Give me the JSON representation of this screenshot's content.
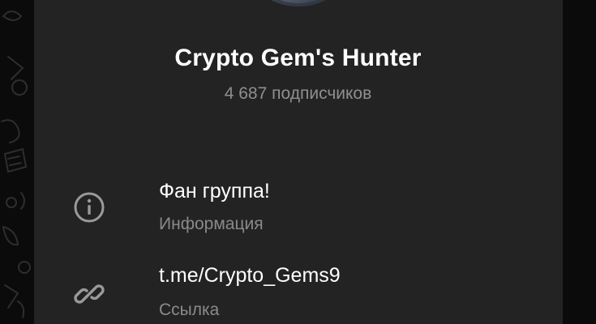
{
  "channel": {
    "name": "Crypto Gem's Hunter",
    "subscribers": "4 687 подписчиков"
  },
  "info_rows": [
    {
      "value": "Фан группа!",
      "label": "Информация",
      "icon": "info-icon"
    },
    {
      "value": "t.me/Crypto_Gems9",
      "label": "Ссылка",
      "icon": "link-icon"
    }
  ],
  "colors": {
    "panel_bg": "#232323",
    "outer_bg": "#0b0b0b",
    "primary_text": "#ffffff",
    "secondary_text": "#8f8f8f",
    "icon": "#9a9a9a"
  }
}
